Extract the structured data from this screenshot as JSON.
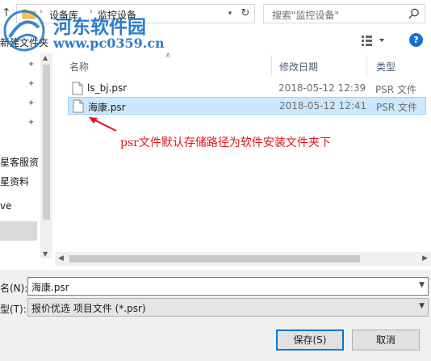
{
  "address": {
    "crumbs": [
      "设备库",
      "监控设备"
    ],
    "separator": "›"
  },
  "search": {
    "placeholder": "搜索\"监控设备\""
  },
  "toolbar": {
    "new_folder": "新建文件夹",
    "help": "?"
  },
  "nav": {
    "items": [
      "星客服资",
      "星资料",
      "ve"
    ]
  },
  "list": {
    "columns": {
      "name": "名称",
      "date": "修改日期",
      "type": "类型"
    },
    "files": [
      {
        "name": "ls_bj.psr",
        "date": "2018-05-12 12:39",
        "type": "PSR 文件",
        "selected": false
      },
      {
        "name": "海康.psr",
        "date": "2018-05-12 12:41",
        "type": "PSR 文件",
        "selected": true
      }
    ]
  },
  "annotation": {
    "text": "psr文件默认存储路径为软件安装文件夹下",
    "color": "#e1151b"
  },
  "form": {
    "filename_label": "名(N):",
    "filename_value": "海康.psr",
    "filetype_label": "型(T):",
    "filetype_value": "报价优选 项目文件 (*.psr)",
    "save_label": "保存(S)",
    "cancel_label": "取消"
  },
  "watermark": {
    "name": "河东软件园",
    "url": "www.pc0359.cn"
  },
  "colors": {
    "accent": "#0078d7",
    "selection": "#cce8ff",
    "watermark": "#1a72c8"
  }
}
